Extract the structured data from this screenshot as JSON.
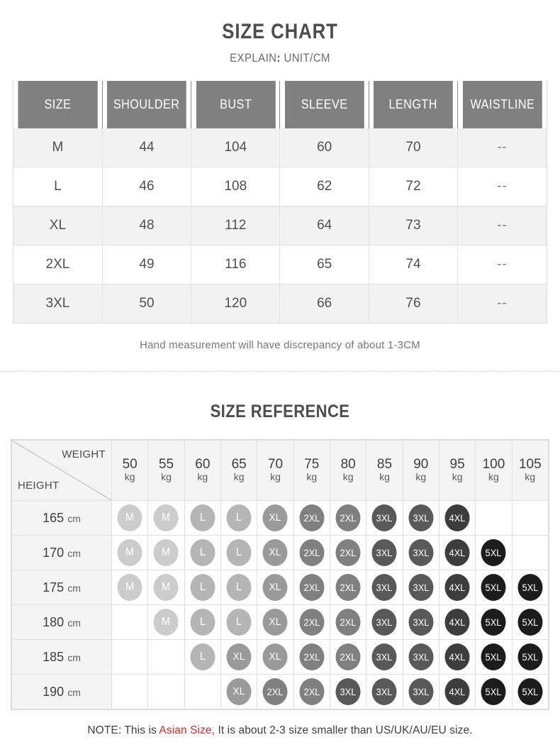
{
  "size_chart": {
    "title": "SIZE CHART",
    "explain_label": "EXPLAIN",
    "explain_colon": ":",
    "explain_value": "UNIT/CM",
    "columns": [
      "SIZE",
      "SHOULDER",
      "BUST",
      "SLEEVE",
      "LENGTH",
      "WAISTLINE"
    ],
    "rows": [
      {
        "size": "M",
        "shoulder": "44",
        "bust": "104",
        "sleeve": "60",
        "length": "70",
        "waistline": "--"
      },
      {
        "size": "L",
        "shoulder": "46",
        "bust": "108",
        "sleeve": "62",
        "length": "72",
        "waistline": "--"
      },
      {
        "size": "XL",
        "shoulder": "48",
        "bust": "112",
        "sleeve": "64",
        "length": "73",
        "waistline": "--"
      },
      {
        "size": "2XL",
        "shoulder": "49",
        "bust": "116",
        "sleeve": "65",
        "length": "74",
        "waistline": "--"
      },
      {
        "size": "3XL",
        "shoulder": "50",
        "bust": "120",
        "sleeve": "66",
        "length": "76",
        "waistline": "--"
      }
    ],
    "hand_note": "Hand measurement will have discrepancy of about 1-3CM"
  },
  "size_reference": {
    "title": "SIZE REFERENCE",
    "weight_label": "WEIGHT",
    "height_label": "HEIGHT",
    "weight_unit": "kg",
    "height_unit": "cm",
    "weights": [
      "50",
      "55",
      "60",
      "65",
      "70",
      "75",
      "80",
      "85",
      "90",
      "95",
      "100",
      "105"
    ],
    "heights": [
      "165",
      "170",
      "175",
      "180",
      "185",
      "190"
    ],
    "grid": [
      [
        "M",
        "M",
        "L",
        "L",
        "XL",
        "2XL",
        "2XL",
        "3XL",
        "3XL",
        "4XL",
        "",
        ""
      ],
      [
        "M",
        "M",
        "L",
        "L",
        "XL",
        "2XL",
        "2XL",
        "3XL",
        "3XL",
        "4XL",
        "5XL",
        ""
      ],
      [
        "M",
        "M",
        "L",
        "L",
        "XL",
        "2XL",
        "2XL",
        "3XL",
        "3XL",
        "4XL",
        "5XL",
        "5XL"
      ],
      [
        "",
        "M",
        "L",
        "L",
        "XL",
        "2XL",
        "2XL",
        "3XL",
        "3XL",
        "4XL",
        "5XL",
        "5XL"
      ],
      [
        "",
        "",
        "L",
        "XL",
        "XL",
        "2XL",
        "2XL",
        "3XL",
        "3XL",
        "4XL",
        "5XL",
        "5XL"
      ],
      [
        "",
        "",
        "",
        "XL",
        "2XL",
        "2XL",
        "3XL",
        "3XL",
        "3XL",
        "4XL",
        "5XL",
        "5XL"
      ]
    ]
  },
  "footer": {
    "note_prefix": "NOTE: This is ",
    "note_highlight": "Asian Size",
    "note_suffix": ", It is about 2-3 size smaller than US/UK/AU/EU size."
  },
  "colors": {
    "header_gray": "#808080",
    "badge_M": "#cccccc",
    "badge_L": "#b5b5b5",
    "badge_XL": "#9a9a9a",
    "badge_2XL": "#808080",
    "badge_3XL": "#595959",
    "badge_4XL": "#3d3d3d",
    "badge_5XL": "#1c1c1c",
    "highlight_red": "#ee2222"
  }
}
